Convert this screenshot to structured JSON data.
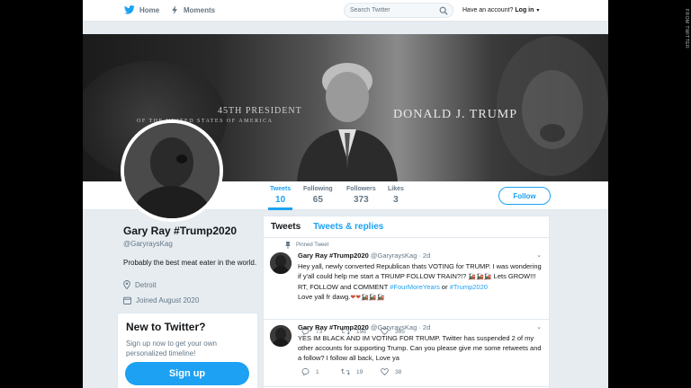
{
  "nav": {
    "home_label": "Home",
    "moments_label": "Moments",
    "search_placeholder": "Search Twitter",
    "account_prompt": "Have an account?",
    "login_label": "Log in",
    "login_caret": "▾"
  },
  "banner": {
    "caption_line1": "45TH PRESIDENT",
    "caption_line2": "OF THE UNITED STATES OF AMERICA",
    "name": "DONALD J. TRUMP"
  },
  "stats": {
    "tweets": {
      "label": "Tweets",
      "value": "10"
    },
    "following": {
      "label": "Following",
      "value": "65"
    },
    "followers": {
      "label": "Followers",
      "value": "373"
    },
    "likes": {
      "label": "Likes",
      "value": "3"
    }
  },
  "follow_label": "Follow",
  "profile": {
    "display_name": "Gary Ray #Trump2020",
    "handle": "@GaryraysKag",
    "bio": "Probably the best meat eater in the world.",
    "location": "Detroit",
    "joined": "Joined August 2020"
  },
  "new_to_twitter": {
    "title": "New to Twitter?",
    "body": "Sign up now to get your own personalized timeline!",
    "signup_label": "Sign up"
  },
  "timeline": {
    "tab_tweets": "Tweets",
    "tab_replies": "Tweets & replies"
  },
  "tweets": [
    {
      "pinned_label": "Pinned Tweet",
      "name": "Gary Ray #Trump2020",
      "handle": "@GaryraysKag · 2d",
      "text_part1": "Hey yall, newly converted Republican thats VOTING for TRUMP. I was wondering if y'all could help me start a TRUMP FOLLOW TRAIN?!? ",
      "train_emoji": "🚂🚂🚂",
      "text_part2": " Lets GROW!!! RT, FOLLOW and COMMENT ",
      "hashtag1": "#FourMoreYears",
      "text_part3": " or ",
      "hashtag2": "#Trump2020",
      "text_part4": "Love yall fr dawg.",
      "heart_emoji": "❤❤",
      "train_emoji2": "🚂🚂🚂",
      "replies": "73",
      "retweets": "198",
      "likes": "395"
    },
    {
      "name": "Gary Ray #Trump2020",
      "handle": "@GaryraysKag · 2d",
      "text": "YES IM BLACK AND IM VOTING FOR TRUMP. Twitter  has suspended 2 of my other accounts for supporting Trump. Can you please give me some retweets and a follow? I follow all back, Love ya",
      "replies": "1",
      "retweets": "19",
      "likes": "38"
    }
  ],
  "photo_credit": "FROM TWITTER",
  "colors": {
    "accent": "#1da1f2",
    "background": "#e6ecf0",
    "muted_text": "#657786"
  }
}
